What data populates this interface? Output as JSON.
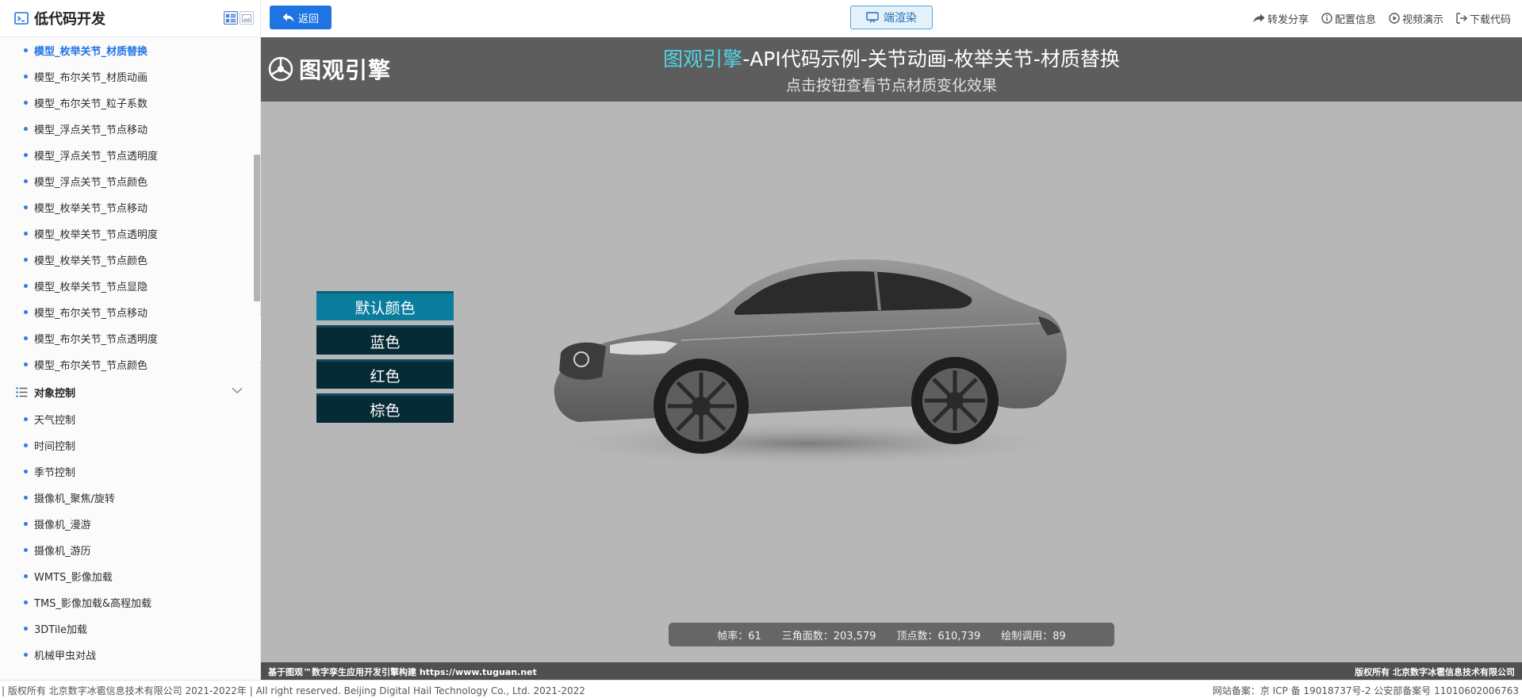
{
  "sidebar": {
    "title": "低代码开发",
    "items_before": [
      {
        "label": "模型_枚举关节_材质替换",
        "active": true
      },
      {
        "label": "模型_布尔关节_材质动画"
      },
      {
        "label": "模型_布尔关节_粒子系数"
      },
      {
        "label": "模型_浮点关节_节点移动"
      },
      {
        "label": "模型_浮点关节_节点透明度"
      },
      {
        "label": "模型_浮点关节_节点颜色"
      },
      {
        "label": "模型_枚举关节_节点移动"
      },
      {
        "label": "模型_枚举关节_节点透明度"
      },
      {
        "label": "模型_枚举关节_节点颜色"
      },
      {
        "label": "模型_枚举关节_节点显隐"
      },
      {
        "label": "模型_布尔关节_节点移动"
      },
      {
        "label": "模型_布尔关节_节点透明度"
      },
      {
        "label": "模型_布尔关节_节点颜色"
      }
    ],
    "group": {
      "label": "对象控制"
    },
    "items_after": [
      {
        "label": "天气控制"
      },
      {
        "label": "时间控制"
      },
      {
        "label": "季节控制"
      },
      {
        "label": "摄像机_聚焦/旋转"
      },
      {
        "label": "摄像机_漫游"
      },
      {
        "label": "摄像机_游历"
      },
      {
        "label": "WMTS_影像加载"
      },
      {
        "label": "TMS_影像加载&高程加载"
      },
      {
        "label": "3DTile加载"
      },
      {
        "label": "机械甲虫对战"
      }
    ]
  },
  "toolbar": {
    "back_label": "返回",
    "render_label": "端渲染",
    "actions": [
      {
        "label": "转发分享",
        "icon": "share-icon"
      },
      {
        "label": "配置信息",
        "icon": "info-icon"
      },
      {
        "label": "视频演示",
        "icon": "play-icon"
      },
      {
        "label": "下载代码",
        "icon": "download-icon"
      }
    ]
  },
  "stage": {
    "brand": "图观引擎",
    "title_highlight": "图观引擎",
    "title_rest": "-API代码示例-关节动画-枚举关节-材质替换",
    "subtitle": "点击按钮查看节点材质变化效果",
    "color_buttons": [
      {
        "label": "默认颜色",
        "selected": true
      },
      {
        "label": "蓝色"
      },
      {
        "label": "红色"
      },
      {
        "label": "棕色"
      }
    ],
    "stats": {
      "fps": "帧率：61",
      "triangles": "三角面数：203,579",
      "vertices": "顶点数：610,739",
      "draw_calls": "绘制调用：89"
    },
    "footer_left": "基于图观™数字孪生应用开发引擎构建 https://www.tuguan.net",
    "footer_right": "版权所有 北京数字冰雹信息技术有限公司"
  },
  "footer": {
    "left": "| 版权所有 北京数字冰雹信息技术有限公司 2021-2022年 | All right reserved. Beijing Digital Hail Technology Co., Ltd. 2021-2022",
    "right": "网站备案：京 ICP 备 19018737号-2 公安部备案号 11010602006763"
  },
  "colors": {
    "accent": "#1f74e3",
    "stage_bg": "#b7b7b7",
    "banner_bg": "#5d5d5d",
    "title_highlight": "#52d6e8",
    "button_default": "#062a36",
    "button_selected": "#0a7d9d"
  }
}
